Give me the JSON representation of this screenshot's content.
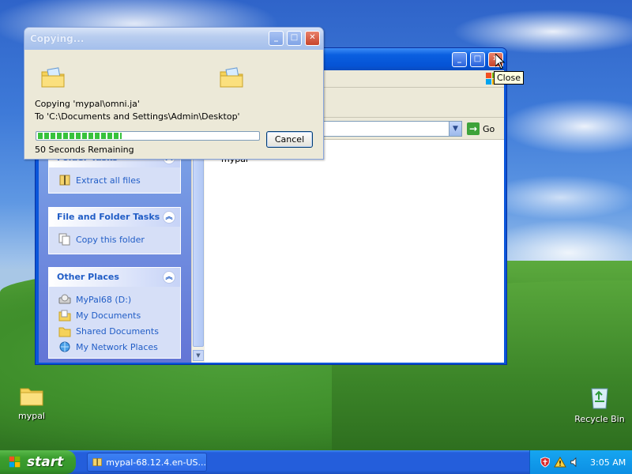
{
  "desktop": {
    "icons": [
      {
        "label": "mypal",
        "icon": "folder-icon"
      },
      {
        "label": "Recycle Bin",
        "icon": "recycle-bin-icon"
      }
    ]
  },
  "explorer": {
    "go_label": "Go",
    "file_items": [
      {
        "label": "mypal",
        "icon": "folder-icon"
      }
    ],
    "task_pane": {
      "folder_tasks": {
        "title": "Folder Tasks",
        "items": [
          {
            "label": "Extract all files",
            "icon": "extract-icon"
          }
        ]
      },
      "file_folder_tasks": {
        "title": "File and Folder Tasks",
        "items": [
          {
            "label": "Copy this folder",
            "icon": "copy-icon"
          }
        ]
      },
      "other_places": {
        "title": "Other Places",
        "items": [
          {
            "label": "MyPal68 (D:)",
            "icon": "drive-icon"
          },
          {
            "label": "My Documents",
            "icon": "documents-icon"
          },
          {
            "label": "Shared Documents",
            "icon": "folder-icon"
          },
          {
            "label": "My Network Places",
            "icon": "network-icon"
          }
        ]
      }
    }
  },
  "tooltip": {
    "text": "Close"
  },
  "copy_dialog": {
    "title": "Copying...",
    "copying_line": "Copying 'mypal\\omni.ja'",
    "to_line": "To 'C:\\Documents and Settings\\Admin\\Desktop'",
    "progress_fraction": 0.38,
    "remaining": "50 Seconds Remaining",
    "cancel_label": "Cancel"
  },
  "taskbar": {
    "start_label": "start",
    "task_item_label": "mypal-68.12.4.en-US...",
    "clock": "3:05 AM"
  },
  "colors": {
    "taskbar_blue": "#245edb",
    "start_green": "#3c9e2f",
    "progress_green": "#37c23c",
    "link_blue": "#215dc6"
  }
}
